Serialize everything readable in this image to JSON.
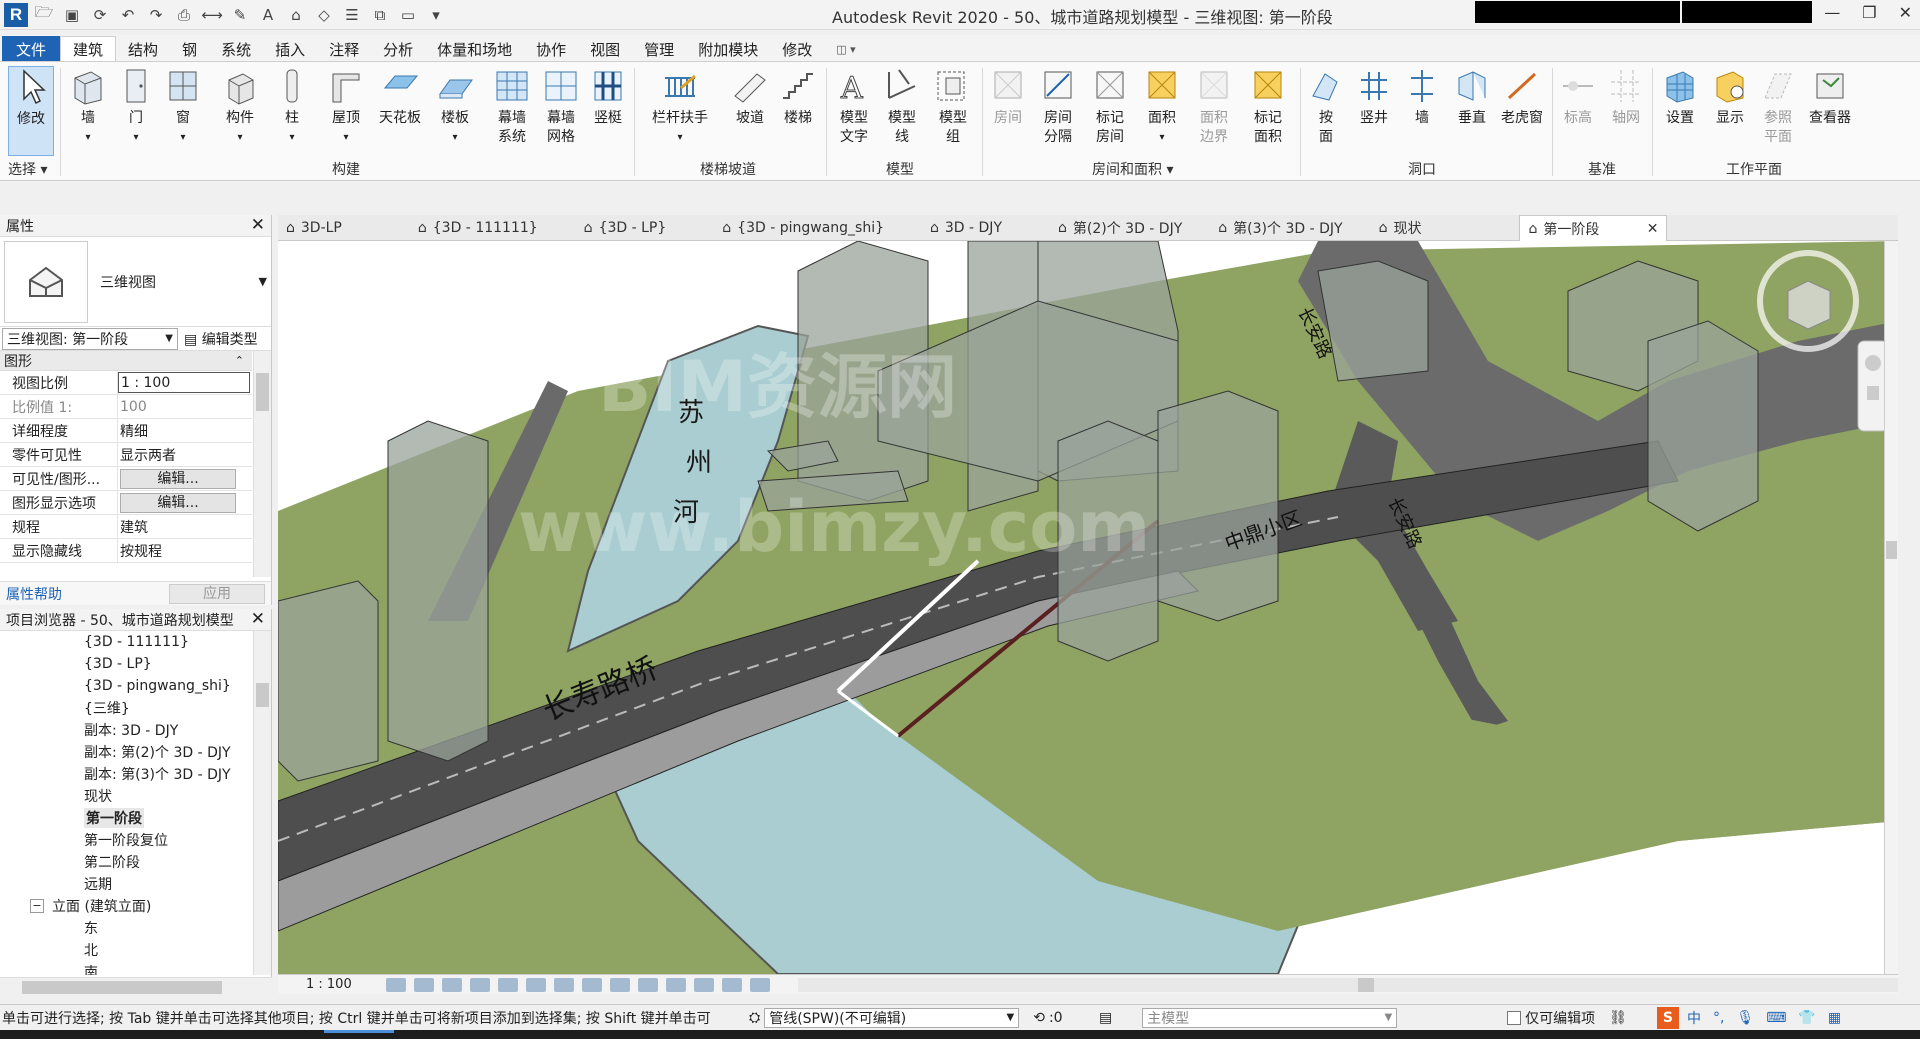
{
  "window": {
    "title": "Autodesk Revit 2020 - 50、城市道路规划模型 - 三维视图: 第一阶段"
  },
  "ribbon_tabs": [
    "文件",
    "建筑",
    "结构",
    "钢",
    "系统",
    "插入",
    "注释",
    "分析",
    "体量和场地",
    "协作",
    "视图",
    "管理",
    "附加模块",
    "修改"
  ],
  "ribbon_buttons": {
    "modify": "修改",
    "select": "选择",
    "wall": "墙",
    "door": "门",
    "window": "窗",
    "component": "构件",
    "column": "柱",
    "roof": "屋顶",
    "ceiling": "天花板",
    "floor": "楼板",
    "curtain_system_1": "幕墙",
    "curtain_system_2": "系统",
    "curtain_grid_1": "幕墙",
    "curtain_grid_2": "网格",
    "mullion": "竖梃",
    "railing": "栏杆扶手",
    "ramp": "坡道",
    "stair": "楼梯",
    "model_text_1": "模型",
    "model_text_2": "文字",
    "model_line_1": "模型",
    "model_line_2": "线",
    "model_group_1": "模型",
    "model_group_2": "组",
    "room": "房间",
    "room_sep_1": "房间",
    "room_sep_2": "分隔",
    "tag_room_1": "标记",
    "tag_room_2": "房间",
    "area": "面积",
    "area_boundary_1": "面积",
    "area_boundary_2": "边界",
    "tag_area_1": "标记",
    "tag_area_2": "面积",
    "by_face_1": "按",
    "by_face_2": "面",
    "shaft": "竖井",
    "wall_opening": "墙",
    "vertical": "垂直",
    "dormer": "老虎窗",
    "level": "标高",
    "grid": "轴网",
    "set": "设置",
    "show": "显示",
    "ref_plane_1": "参照",
    "ref_plane_2": "平面",
    "viewer": "查看器"
  },
  "ribbon_groups": [
    "构建",
    "楼梯坡道",
    "模型",
    "房间和面积 ▾",
    "洞口",
    "基准",
    "工作平面"
  ],
  "properties": {
    "title": "属性",
    "type_name": "三维视图",
    "instance_selector": "三维视图: 第一阶段",
    "edit_type": "编辑类型",
    "section": "图形",
    "rows": [
      {
        "k": "视图比例",
        "v": "1 : 100"
      },
      {
        "k": "比例值 1:",
        "v": "100"
      },
      {
        "k": "详细程度",
        "v": "精细"
      },
      {
        "k": "零件可见性",
        "v": "显示两者"
      },
      {
        "k": "可见性/图形...",
        "v": "编辑..."
      },
      {
        "k": "图形显示选项",
        "v": "编辑..."
      },
      {
        "k": "规程",
        "v": "建筑"
      },
      {
        "k": "显示隐藏线",
        "v": "按规程"
      }
    ],
    "help": "属性帮助",
    "apply": "应用"
  },
  "browser": {
    "title": "项目浏览器 - 50、城市道路规划模型",
    "items": [
      "{3D - 111111}",
      "{3D - LP}",
      "{3D - pingwang_shi}",
      "{三维}",
      "副本: 3D - DJY",
      "副本: 第(2)个 3D - DJY",
      "副本: 第(3)个 3D - DJY",
      "现状",
      "第一阶段",
      "第一阶段复位",
      "第二阶段",
      "远期",
      "立面 (建筑立面)",
      "东",
      "北",
      "南"
    ]
  },
  "view_tabs": [
    "3D-LP",
    "{3D - 111111}",
    "{3D - LP}",
    "{3D - pingwang_shi}",
    "3D - DJY",
    "第(2)个 3D - DJY",
    "第(3)个 3D - DJY",
    "现状",
    "第一阶段"
  ],
  "model_labels": {
    "river_1": "苏",
    "river_2": "州",
    "river_3": "河",
    "bridge": "长寿路桥",
    "road1": "长安路",
    "road2": "长安路",
    "community": "中鼎小区",
    "watermark1": "BIM资源网",
    "watermark2": "www.bimzy.com"
  },
  "view_control": {
    "scale": "1 : 100"
  },
  "status": {
    "message": "单击可进行选择; 按 Tab 键并单击可选择其他项目; 按 Ctrl 键并单击可将新项目添加到选择集; 按 Shift 键并单击可",
    "workset": "管线(SPW)(不可编辑)",
    "counter": ":0",
    "design_option": "主模型",
    "editable_only": "仅可编辑项",
    "ime": "中"
  },
  "colors": {
    "accent": "#1f64b4",
    "grass": "#8fa462",
    "water": "#a9cdd0",
    "road": "#4e4e4e"
  }
}
